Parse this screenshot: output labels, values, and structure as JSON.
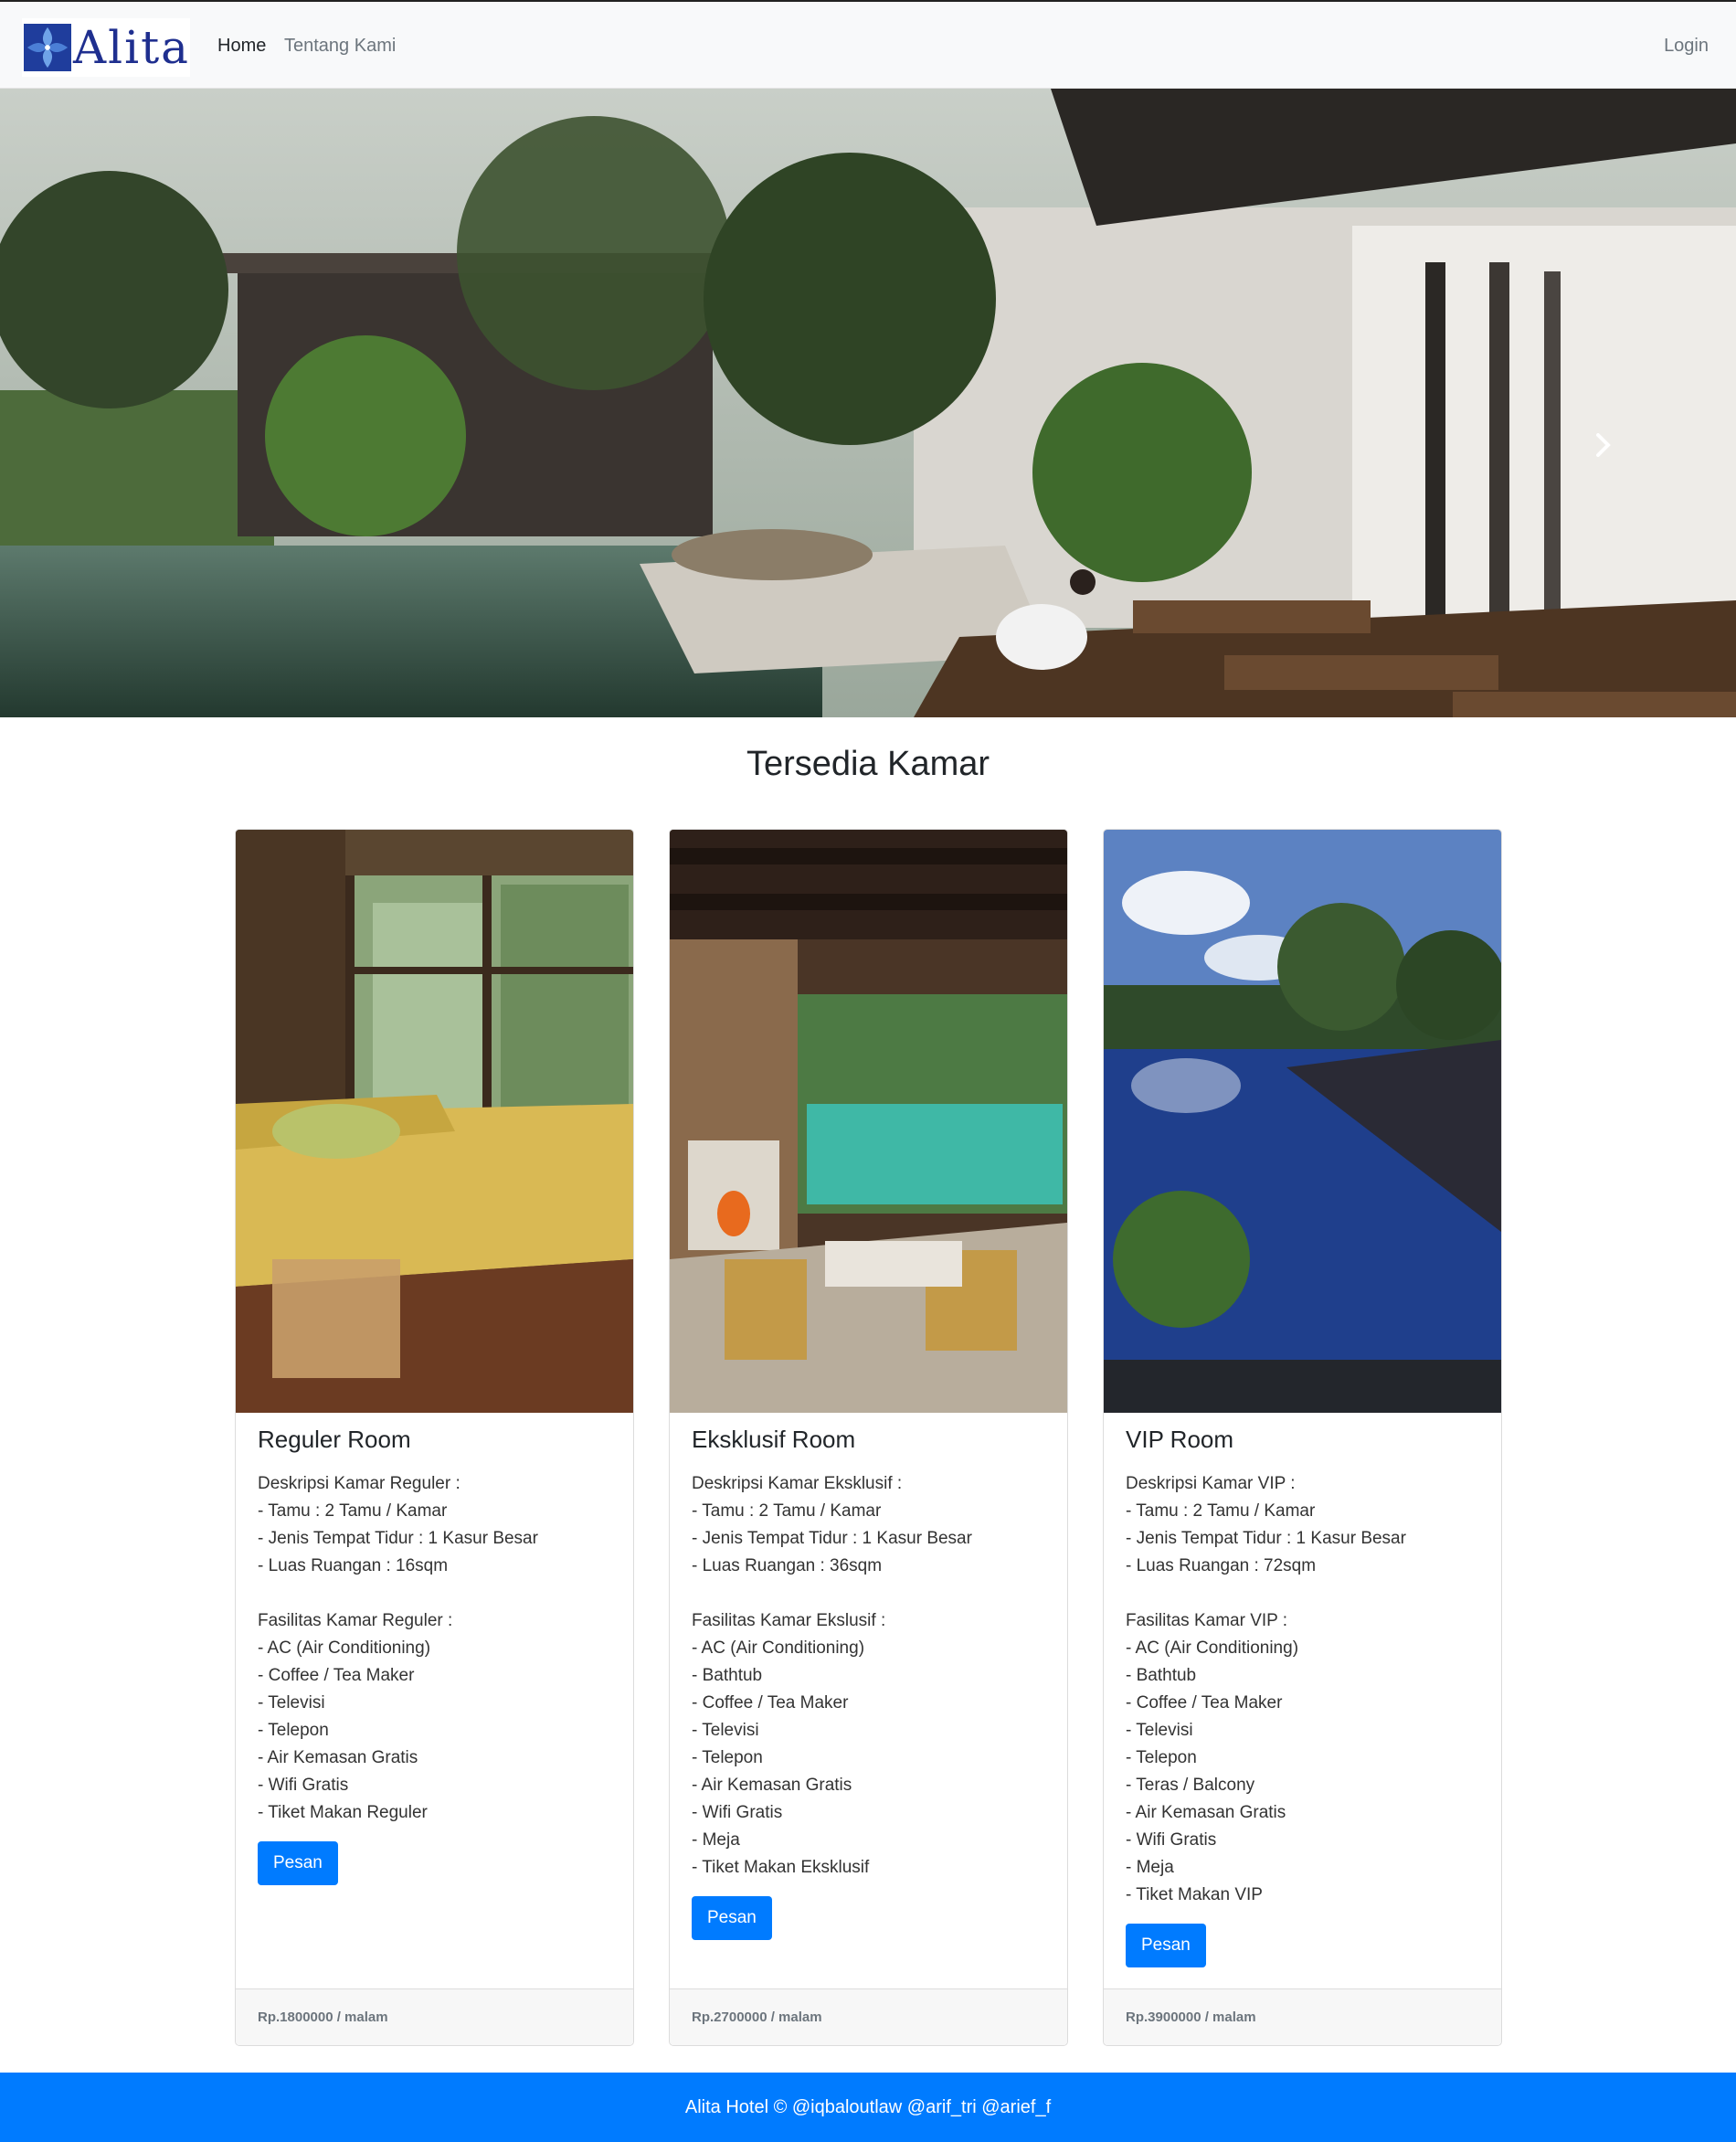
{
  "brand": {
    "name": "Alita"
  },
  "nav": {
    "home": "Home",
    "about": "Tentang Kami",
    "login": "Login"
  },
  "carousel": {
    "slide_count": 6,
    "active_index": 0
  },
  "section": {
    "title": "Tersedia Kamar"
  },
  "rooms": [
    {
      "title": "Reguler Room",
      "desc_heading": "Deskripsi Kamar Reguler :",
      "desc": [
        "- Tamu : 2 Tamu / Kamar",
        "- Jenis Tempat Tidur : 1 Kasur Besar",
        "- Luas Ruangan : 16sqm"
      ],
      "fac_heading": "Fasilitas Kamar Reguler :",
      "facilities": [
        "- AC (Air Conditioning)",
        "- Coffee / Tea Maker",
        "- Televisi",
        "- Telepon",
        "- Air Kemasan Gratis",
        "- Wifi Gratis",
        "- Tiket Makan Reguler"
      ],
      "button": "Pesan",
      "price": "Rp.1800000 / malam"
    },
    {
      "title": "Eksklusif Room",
      "desc_heading": "Deskripsi Kamar Eksklusif :",
      "desc": [
        "- Tamu : 2 Tamu / Kamar",
        "- Jenis Tempat Tidur : 1 Kasur Besar",
        "- Luas Ruangan : 36sqm"
      ],
      "fac_heading": "Fasilitas Kamar Ekslusif :",
      "facilities": [
        "- AC (Air Conditioning)",
        "- Bathtub",
        "- Coffee / Tea Maker",
        "- Televisi",
        "- Telepon",
        "- Air Kemasan Gratis",
        "- Wifi Gratis",
        "- Meja",
        "- Tiket Makan Eksklusif"
      ],
      "button": "Pesan",
      "price": "Rp.2700000 / malam"
    },
    {
      "title": "VIP Room",
      "desc_heading": "Deskripsi Kamar VIP :",
      "desc": [
        "- Tamu : 2 Tamu / Kamar",
        "- Jenis Tempat Tidur : 1 Kasur Besar",
        "- Luas Ruangan : 72sqm"
      ],
      "fac_heading": "Fasilitas Kamar VIP :",
      "facilities": [
        "- AC (Air Conditioning)",
        "- Bathtub",
        "- Coffee / Tea Maker",
        "- Televisi",
        "- Telepon",
        "- Teras / Balcony",
        "- Air Kemasan Gratis",
        "- Wifi Gratis",
        "- Meja",
        "- Tiket Makan VIP"
      ],
      "button": "Pesan",
      "price": "Rp.3900000 / malam"
    }
  ],
  "footer": {
    "text": "Alita Hotel © @iqbaloutlaw @arif_tri @arief_f"
  },
  "colors": {
    "primary": "#007bff",
    "navbar_bg": "#f8f9fa",
    "brand_blue": "#1f2f8f"
  }
}
